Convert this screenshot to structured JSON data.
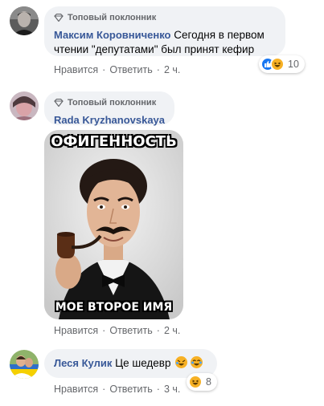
{
  "comments": [
    {
      "badge": "Топовый поклонник",
      "author": "Максим Коровниченко",
      "text_line1": "Сегодня в первом",
      "text_line2": "чтении \"депутатами\" был принят кефир",
      "actions": {
        "like": "Нравится",
        "reply": "Ответить",
        "time": "2 ч."
      },
      "reactions": {
        "icons": [
          "like-icon",
          "haha-icon"
        ],
        "count": "10"
      }
    },
    {
      "badge": "Топовый поклонник",
      "author": "Rada Kryzhanovskaya",
      "meme": {
        "top_caption": "ОФИГЕННОСТЬ",
        "bottom_caption": "МОЕ ВТОРОЕ ИМЯ"
      },
      "actions": {
        "like": "Нравится",
        "reply": "Ответить",
        "time": "2 ч."
      }
    },
    {
      "author": "Леся Кулик",
      "text": "Це шедевр",
      "actions": {
        "like": "Нравится",
        "reply": "Ответить",
        "time": "3 ч."
      },
      "reactions": {
        "icons": [
          "haha-icon",
          "haha-icon"
        ],
        "count": "8"
      }
    }
  ],
  "colors": {
    "link": "#385898",
    "bubble": "#f0f2f5",
    "meta": "#65676b",
    "like": "#1877f2",
    "haha": "#f7b125"
  }
}
